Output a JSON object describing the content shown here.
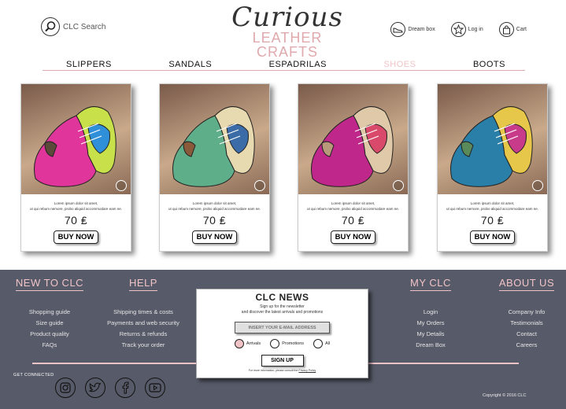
{
  "header": {
    "search_label": "CLC Search",
    "logo_script": "Curious",
    "logo_sub": "LEATHER CRAFTS",
    "tools": [
      {
        "label": "Dream box",
        "icon": "shoe-icon"
      },
      {
        "label": "Log in",
        "icon": "star-icon"
      },
      {
        "label": "Cart",
        "icon": "bag-icon"
      }
    ]
  },
  "nav": {
    "items": [
      {
        "label": "SLIPPERS",
        "active": false
      },
      {
        "label": "SANDALS",
        "active": false
      },
      {
        "label": "ESPADRILAS",
        "active": false
      },
      {
        "label": "SHOES",
        "active": true
      },
      {
        "label": "BOOTS",
        "active": false
      }
    ]
  },
  "products": [
    {
      "desc1": "Lorem ipsum dolor sit amet,",
      "desc2": "ut qui rebum nemore, probo aliquid accommodare eam ne.",
      "price": "70 ₤",
      "buy": "BUY NOW",
      "colors": [
        "#e0359a",
        "#c8e04a",
        "#2f8fd8",
        "#5b4a3a"
      ]
    },
    {
      "desc1": "Lorem ipsum dolor sit amet,",
      "desc2": "ut qui rebum nemore, probo aliquid accommodare eam ne.",
      "price": "70 ₤",
      "buy": "BUY NOW",
      "colors": [
        "#5fae8a",
        "#e7d9b0",
        "#3b6ca8",
        "#8a5a3a"
      ]
    },
    {
      "desc1": "Lorem ipsum dolor sit amet,",
      "desc2": "ut qui rebum nemore, probo aliquid accommodare eam ne.",
      "price": "70 ₤",
      "buy": "BUY NOW",
      "colors": [
        "#c0278a",
        "#e0c9a8",
        "#d94a6a",
        "#b89a7a"
      ]
    },
    {
      "desc1": "Lorem ipsum dolor sit amet,",
      "desc2": "ut qui rebum nemore, probo aliquid accommodare eam ne.",
      "price": "70 ₤",
      "buy": "BUY NOW",
      "colors": [
        "#2a7fa8",
        "#e6c74a",
        "#c83a8a",
        "#5a8a5a"
      ]
    }
  ],
  "footer": {
    "new_to_clc": {
      "title": "NEW TO CLC",
      "links": [
        "Shopping guide",
        "Size guide",
        "Product quality",
        "FAQs"
      ]
    },
    "help": {
      "title": "HELP",
      "links": [
        "Shipping times & costs",
        "Payments and web security",
        "Returns & refunds",
        "Track your order"
      ]
    },
    "my_clc": {
      "title": "MY CLC",
      "links": [
        "Login",
        "My Orders",
        "My Details",
        "Dream Box"
      ]
    },
    "about_us": {
      "title": "ABOUT US",
      "links": [
        "Company Info",
        "Testimonials",
        "Contact",
        "Careers"
      ]
    },
    "get_connected": "GET CONNECTED",
    "socials": [
      "instagram-icon",
      "twitter-icon",
      "facebook-icon",
      "youtube-icon"
    ],
    "copyright": "Copyright © 2016 CLC"
  },
  "newsletter": {
    "title": "CLC NEWS",
    "sub1": "Sign up for the newsletter",
    "sub2": "and discover the latest arrivals and promotions",
    "input_placeholder": "INSERT YOUR E-MAIL ADDRESS",
    "options": [
      {
        "label": "Arrivals",
        "selected": true
      },
      {
        "label": "Promotions",
        "selected": false
      },
      {
        "label": "All",
        "selected": false
      }
    ],
    "signup": "SIGN UP",
    "note_prefix": "For more information, please consult the ",
    "note_link": "Privacy Policy"
  },
  "colors": {
    "accent": "#f0c3c7",
    "footer_bg": "#575a68"
  }
}
